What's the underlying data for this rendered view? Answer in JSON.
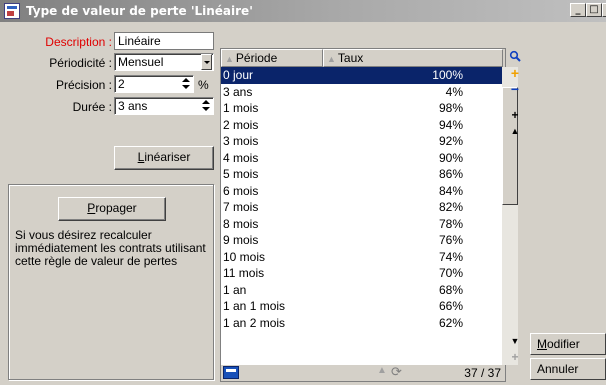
{
  "window": {
    "title": "Type de valeur de perte 'Linéaire'",
    "buttons": {
      "minimize": "_",
      "maximize": "□",
      "close": "×"
    }
  },
  "form": {
    "description": {
      "label": "Description :",
      "value": "Linéaire"
    },
    "periodicite": {
      "label": "Périodicité :",
      "value": "Mensuel"
    },
    "precision": {
      "label": "Précision :",
      "value": "2",
      "unit": "%"
    },
    "duree": {
      "label": "Durée :",
      "value": "3 ans"
    },
    "lineariser": {
      "pre": "",
      "mnemonic": "L",
      "post": "inéariser"
    }
  },
  "propagate": {
    "button": {
      "mnemonic": "P",
      "post": "ropager"
    },
    "help": "Si vous désirez recalculer immédiatement les contrats utilisant cette règle de valeur de pertes"
  },
  "list": {
    "columns": [
      "Période",
      "Taux"
    ],
    "rows": [
      {
        "periode": "0 jour",
        "taux": "100%",
        "selected": true
      },
      {
        "periode": "3 ans",
        "taux": "4%"
      },
      {
        "periode": "1 mois",
        "taux": "98%"
      },
      {
        "periode": "2 mois",
        "taux": "94%"
      },
      {
        "periode": "3 mois",
        "taux": "92%"
      },
      {
        "periode": "4 mois",
        "taux": "90%"
      },
      {
        "periode": "5 mois",
        "taux": "86%"
      },
      {
        "periode": "6 mois",
        "taux": "84%"
      },
      {
        "periode": "7 mois",
        "taux": "82%"
      },
      {
        "periode": "8 mois",
        "taux": "78%"
      },
      {
        "periode": "9 mois",
        "taux": "76%"
      },
      {
        "periode": "10 mois",
        "taux": "74%"
      },
      {
        "periode": "11 mois",
        "taux": "70%"
      },
      {
        "periode": "1 an",
        "taux": "68%"
      },
      {
        "periode": "1 an 1 mois",
        "taux": "66%"
      },
      {
        "periode": "1 an 2 mois",
        "taux": "62%"
      }
    ],
    "count": "37 / 37"
  },
  "sidetools": {
    "add": "+",
    "remove": "−",
    "plus_small": "+",
    "up": "▲",
    "down": "▼"
  },
  "actions": {
    "modifier": {
      "mnemonic": "M",
      "post": "odifier"
    },
    "annuler": "Annuler"
  },
  "colors": {
    "selection": "#0a246a",
    "required_label": "#e00000",
    "add_icon": "#f0a000",
    "remove_icon": "#1040c0"
  }
}
